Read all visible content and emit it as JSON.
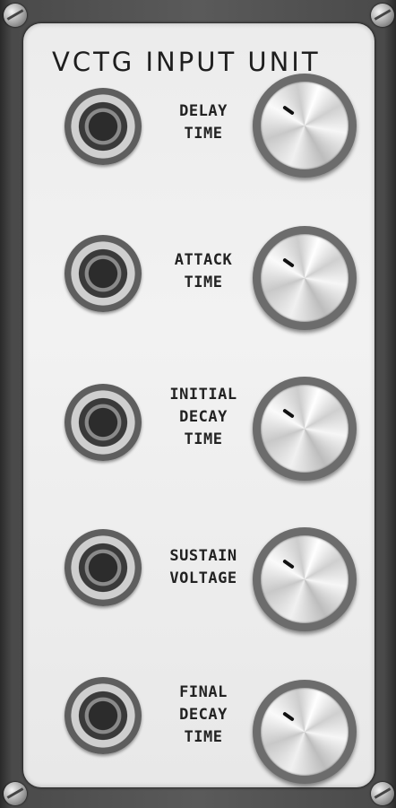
{
  "panel": {
    "title": "VCTG INPUT UNIT"
  },
  "channels": [
    {
      "label_lines": [
        "DELAY",
        "TIME"
      ]
    },
    {
      "label_lines": [
        "ATTACK",
        "TIME"
      ]
    },
    {
      "label_lines": [
        "INITIAL",
        "DECAY",
        "TIME"
      ]
    },
    {
      "label_lines": [
        "SUSTAIN",
        "VOLTAGE"
      ]
    },
    {
      "label_lines": [
        "FINAL",
        "DECAY",
        "TIME"
      ]
    }
  ],
  "colors": {
    "plate": "#ececec",
    "frame": "#4a4a4a",
    "text": "#222222"
  }
}
